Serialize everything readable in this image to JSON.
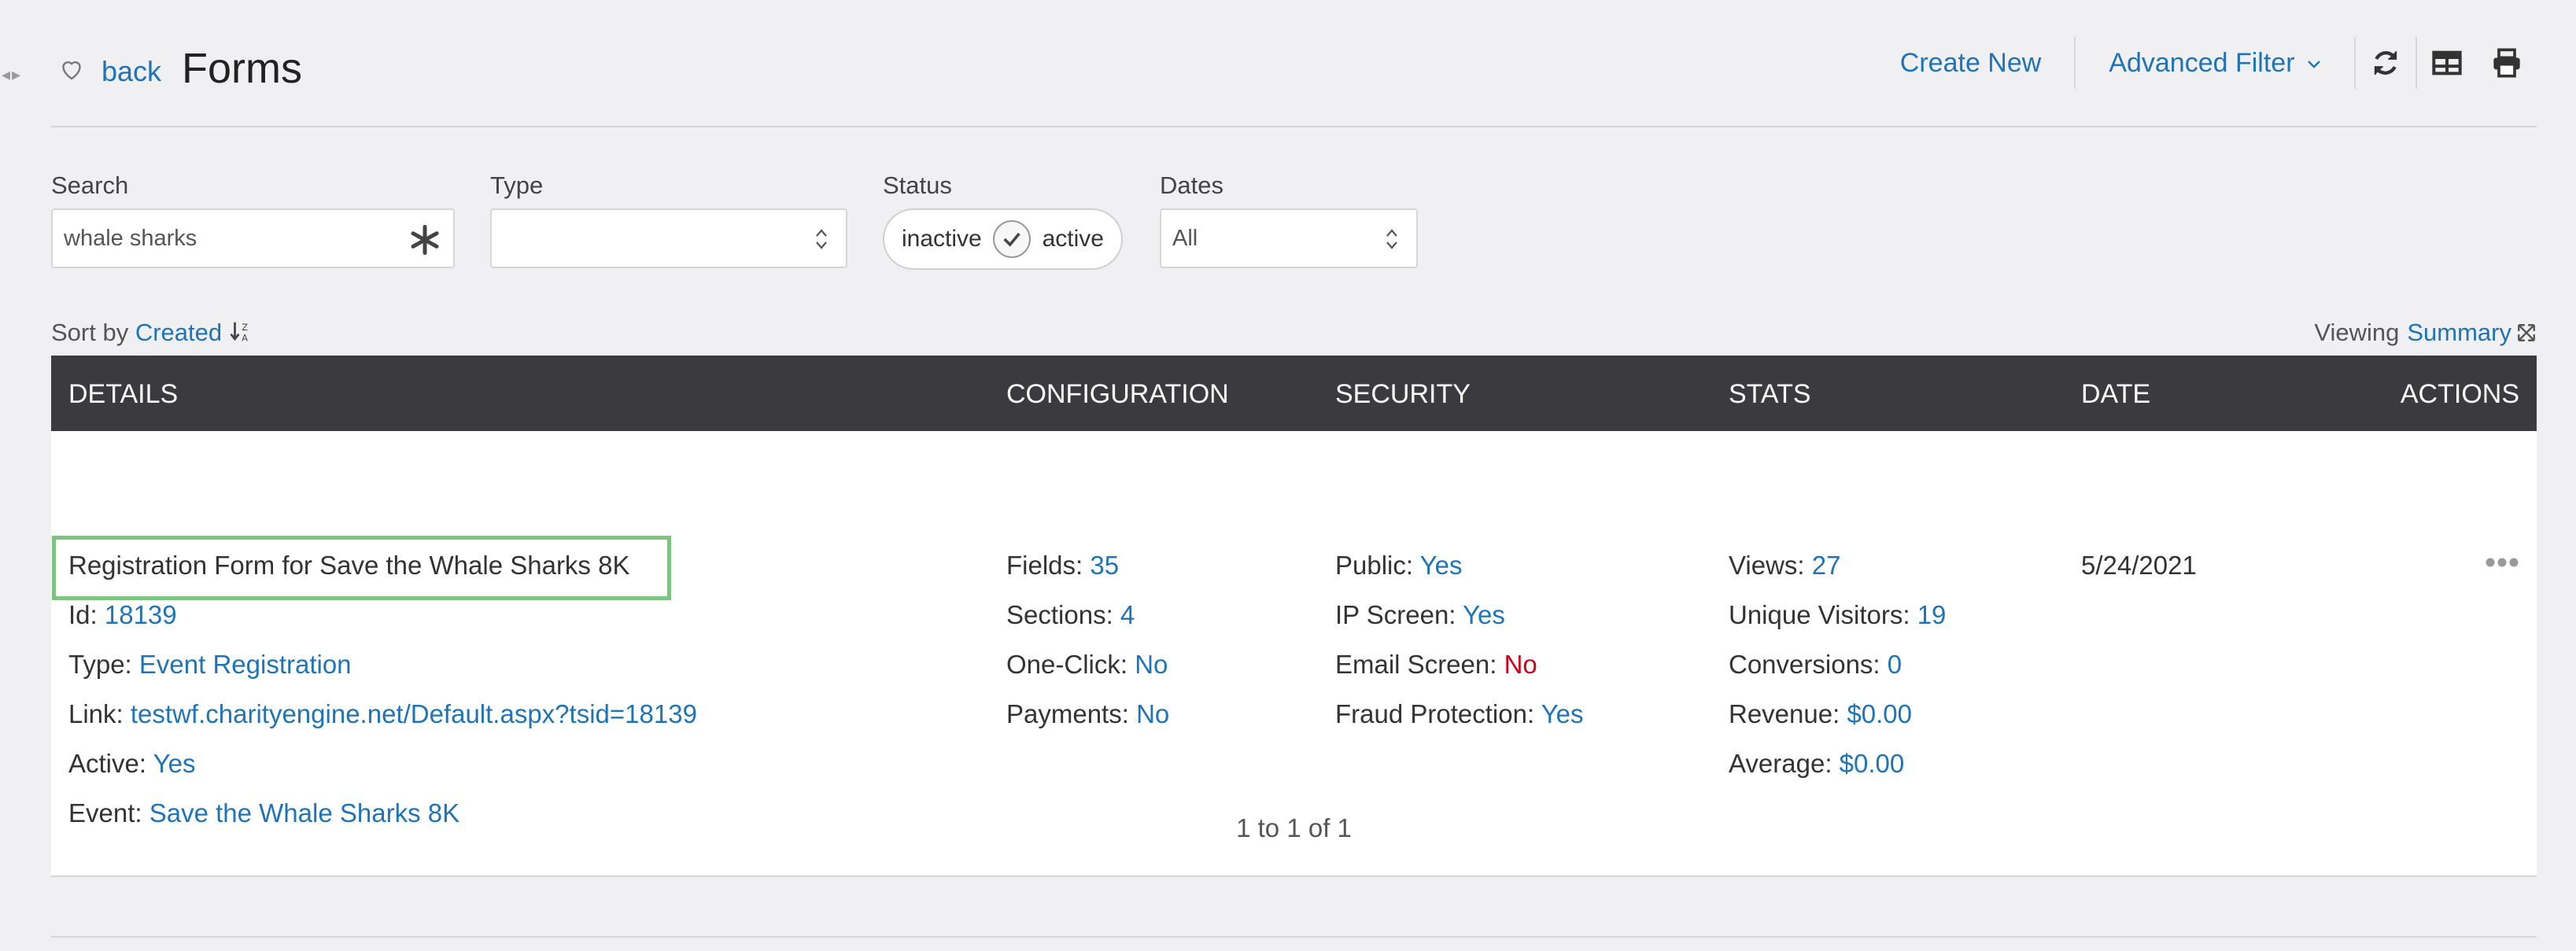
{
  "header": {
    "back_label": "back",
    "title": "Forms",
    "create_new": "Create New",
    "advanced_filter": "Advanced Filter"
  },
  "icons": {
    "favorite": "heart-outline-icon",
    "refresh": "refresh-icon",
    "table": "table-icon",
    "print": "print-icon",
    "clear": "asterisk-icon",
    "sort_direction": "sort-desc-icon",
    "expand": "expand-icon",
    "more": "ellipsis-icon"
  },
  "filters": {
    "search_label": "Search",
    "search_value": "whale sharks",
    "type_label": "Type",
    "type_value": "",
    "status_label": "Status",
    "status_inactive": "inactive",
    "status_active": "active",
    "dates_label": "Dates",
    "dates_value": "All"
  },
  "sort": {
    "prefix": "Sort by",
    "field": "Created"
  },
  "viewing": {
    "prefix": "Viewing",
    "mode": "Summary"
  },
  "table": {
    "columns": [
      "DETAILS",
      "CONFIGURATION",
      "SECURITY",
      "STATS",
      "DATE",
      "ACTIONS"
    ],
    "row": {
      "details": {
        "title": "Registration Form for Save the Whale Sharks 8K",
        "id_label": "Id:",
        "id_value": "18139",
        "type_label": "Type:",
        "type_value": "Event Registration",
        "link_label": "Link:",
        "link_value": "testwf.charityengine.net/Default.aspx?tsid=18139",
        "active_label": "Active:",
        "active_value": "Yes",
        "event_label": "Event:",
        "event_value": "Save the Whale Sharks 8K"
      },
      "configuration": {
        "fields_label": "Fields:",
        "fields_value": "35",
        "sections_label": "Sections:",
        "sections_value": "4",
        "oneclick_label": "One-Click:",
        "oneclick_value": "No",
        "payments_label": "Payments:",
        "payments_value": "No"
      },
      "security": {
        "public_label": "Public:",
        "public_value": "Yes",
        "ipscreen_label": "IP Screen:",
        "ipscreen_value": "Yes",
        "emailscreen_label": "Email Screen:",
        "emailscreen_value": "No",
        "fraud_label": "Fraud Protection:",
        "fraud_value": "Yes"
      },
      "stats": {
        "views_label": "Views:",
        "views_value": "27",
        "unique_label": "Unique Visitors:",
        "unique_value": "19",
        "conv_label": "Conversions:",
        "conv_value": "0",
        "revenue_label": "Revenue:",
        "revenue_value": "$0.00",
        "average_label": "Average:",
        "average_value": "$0.00"
      },
      "date": "5/24/2021"
    }
  },
  "pager": "1 to 1 of 1",
  "colors": {
    "link": "#1f73b7",
    "header_bg": "#3b3b3f",
    "highlight": "#7cc47f",
    "negative": "#d0021b"
  }
}
